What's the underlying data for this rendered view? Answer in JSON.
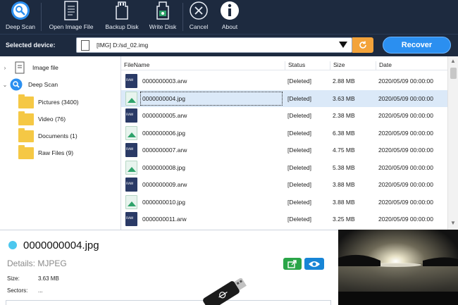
{
  "toolbar": {
    "items": [
      {
        "label": "Deep Scan",
        "icon": "deep-scan-icon"
      },
      {
        "label": "Open Image File",
        "icon": "document-icon"
      },
      {
        "label": "Backup Disk",
        "icon": "backup-disk-icon"
      },
      {
        "label": "Write Disk",
        "icon": "write-disk-icon"
      },
      {
        "label": "Cancel",
        "icon": "cancel-icon"
      },
      {
        "label": "About",
        "icon": "info-icon"
      }
    ]
  },
  "device_bar": {
    "label": "Selected device:",
    "value": "[IMG] D:/sd_02.img",
    "recover_label": "Recover"
  },
  "tree": {
    "image_file": "Image file",
    "deep_scan": "Deep Scan",
    "folders": [
      {
        "label": "Pictures (3400)"
      },
      {
        "label": "Video (76)"
      },
      {
        "label": "Documents (1)"
      },
      {
        "label": "Raw Files (9)"
      }
    ]
  },
  "table": {
    "headers": {
      "filename": "FileName",
      "status": "Status",
      "size": "Size",
      "date": "Date"
    },
    "rows": [
      {
        "name": "0000000003.arw",
        "type": "raw",
        "status": "[Deleted]",
        "size": "2.88 MB",
        "date": "2020/05/09 00:00:00"
      },
      {
        "name": "0000000004.jpg",
        "type": "jpg",
        "status": "[Deleted]",
        "size": "3.63 MB",
        "date": "2020/05/09 00:00:00",
        "selected": true
      },
      {
        "name": "0000000005.arw",
        "type": "raw",
        "status": "[Deleted]",
        "size": "2.38 MB",
        "date": "2020/05/09 00:00:00"
      },
      {
        "name": "0000000006.jpg",
        "type": "jpg",
        "status": "[Deleted]",
        "size": "6.38 MB",
        "date": "2020/05/09 00:00:00"
      },
      {
        "name": "0000000007.arw",
        "type": "raw",
        "status": "[Deleted]",
        "size": "4.75 MB",
        "date": "2020/05/09 00:00:00"
      },
      {
        "name": "0000000008.jpg",
        "type": "jpg",
        "status": "[Deleted]",
        "size": "5.38 MB",
        "date": "2020/05/09 00:00:00"
      },
      {
        "name": "0000000009.arw",
        "type": "raw",
        "status": "[Deleted]",
        "size": "3.88 MB",
        "date": "2020/05/09 00:00:00"
      },
      {
        "name": "0000000010.jpg",
        "type": "jpg",
        "status": "[Deleted]",
        "size": "3.88 MB",
        "date": "2020/05/09 00:00:00"
      },
      {
        "name": "0000000011.arw",
        "type": "raw",
        "status": "[Deleted]",
        "size": "3.25 MB",
        "date": "2020/05/09 00:00:00"
      }
    ]
  },
  "details": {
    "title": "0000000004.jpg",
    "subtitle": "Details: MJPEG",
    "size_label": "Size:",
    "size_value": "3.63 MB",
    "sectors_label": "Sectors:",
    "sectors_value": "..."
  },
  "colors": {
    "toolbar_bg": "#1d2a3f",
    "accent": "#2b8ff0",
    "refresh": "#f3a33a",
    "folder": "#f5c845",
    "selection": "#dbe9f8"
  }
}
